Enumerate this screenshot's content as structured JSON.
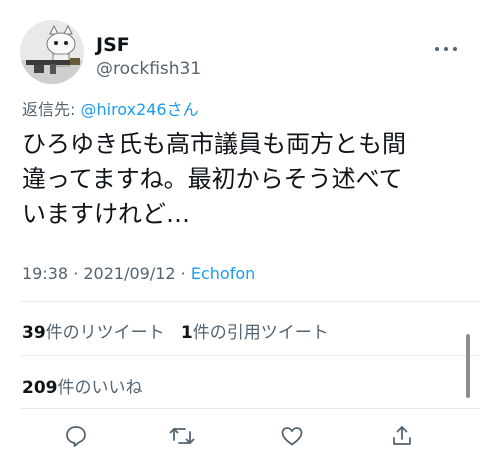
{
  "author": {
    "name": "JSF",
    "handle": "@rockfish31"
  },
  "more_icon": "ellipsis-icon",
  "reply_to": {
    "prefix": "返信先: ",
    "mention": "@hirox246さん"
  },
  "tweet_text_lines": [
    "ひろゆき氏も高市議員も両方とも間",
    "違ってますね。最初からそう述べて",
    "いますけれど…"
  ],
  "meta": {
    "time": "19:38",
    "sep1": " · ",
    "date": "2021/09/12",
    "sep2": " · ",
    "client": "Echofon"
  },
  "stats": {
    "retweets_count": "39",
    "retweets_label": "件のリツイート",
    "quotes_count": "1",
    "quotes_label": "件の引用ツイート",
    "likes_count": "209",
    "likes_label": "件のいいね"
  },
  "actions": [
    "reply-icon",
    "retweet-icon",
    "like-icon",
    "share-icon"
  ],
  "colors": {
    "accent": "#1d9bf0",
    "secondary_text": "#536471",
    "divider": "#e6ecf0"
  }
}
